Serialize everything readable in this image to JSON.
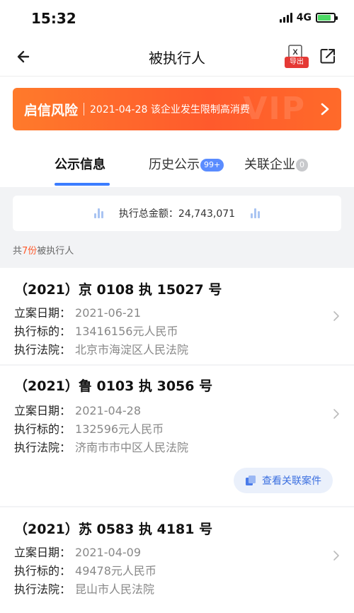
{
  "status": {
    "time": "15:32",
    "network": "4G"
  },
  "nav": {
    "title": "被执行人",
    "export_label": "导出"
  },
  "risk": {
    "title": "启信风险",
    "text": "2021-04-28 该企业发生限制高消费",
    "watermark": "VIP"
  },
  "tabs": [
    {
      "label": "公示信息",
      "badge": ""
    },
    {
      "label": "历史公示",
      "badge": "99+"
    },
    {
      "label": "关联企业",
      "badge": "0"
    }
  ],
  "summary": {
    "amount_label": "执行总金额：",
    "amount_value": "24,743,071",
    "count_prefix": "共",
    "count": "7份",
    "count_suffix": "被执行人"
  },
  "labels": {
    "filing_date": "立案日期：",
    "target": "执行标的：",
    "court": "执行法院："
  },
  "cases": [
    {
      "case_no": "（2021）京 0108 执 15027 号",
      "filing_date": "2021-06-21",
      "target": "13416156元人民币",
      "court": "北京市海淀区人民法院"
    },
    {
      "case_no": "（2021）鲁 0103 执 3056 号",
      "filing_date": "2021-04-28",
      "target": "132596元人民币",
      "court": "济南市市中区人民法院",
      "related_label": "查看关联案件"
    },
    {
      "case_no": "（2021）苏 0583 执 4181 号",
      "filing_date": "2021-04-09",
      "target": "49478元人民币",
      "court": "昆山市人民法院"
    }
  ],
  "colors": {
    "accent": "#3b7cff",
    "risk": "#ff5a2c",
    "badge_blue": "#5a8cff"
  }
}
